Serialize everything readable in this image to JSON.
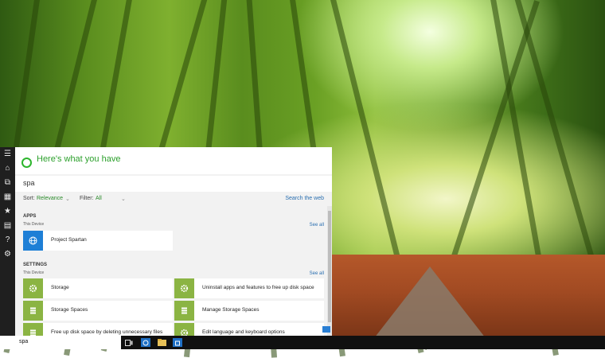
{
  "panel": {
    "header_title": "Here's what you have",
    "query": "spa",
    "sort_label": "Sort:",
    "sort_value": "Relevance",
    "filter_label": "Filter:",
    "filter_value": "All",
    "search_web": "Search the web"
  },
  "apps": {
    "title": "APPS",
    "subtitle": "This Device",
    "see_all": "See all",
    "items": [
      {
        "label": "Project Spartan",
        "icon": "globe-icon"
      }
    ]
  },
  "settings": {
    "title": "SETTINGS",
    "subtitle": "This Device",
    "see_all": "See all",
    "items": [
      {
        "label": "Storage",
        "icon": "gear-icon"
      },
      {
        "label": "Uninstall apps and features to free up disk space",
        "icon": "gear-icon"
      },
      {
        "label": "Storage Spaces",
        "icon": "storage-spaces-icon"
      },
      {
        "label": "Manage Storage Spaces",
        "icon": "storage-spaces-icon"
      },
      {
        "label": "Free up disk space by deleting unnecessary files",
        "icon": "storage-spaces-icon"
      },
      {
        "label": "Edit language and keyboard options",
        "icon": "gear-icon"
      }
    ]
  },
  "taskbar": {
    "search_text": "spa"
  },
  "colors": {
    "accent_green": "#2ca02c",
    "tile_icon_blue": "#1e7fd6",
    "tile_icon_green": "#8bb443",
    "link_blue": "#2a6fb0"
  }
}
